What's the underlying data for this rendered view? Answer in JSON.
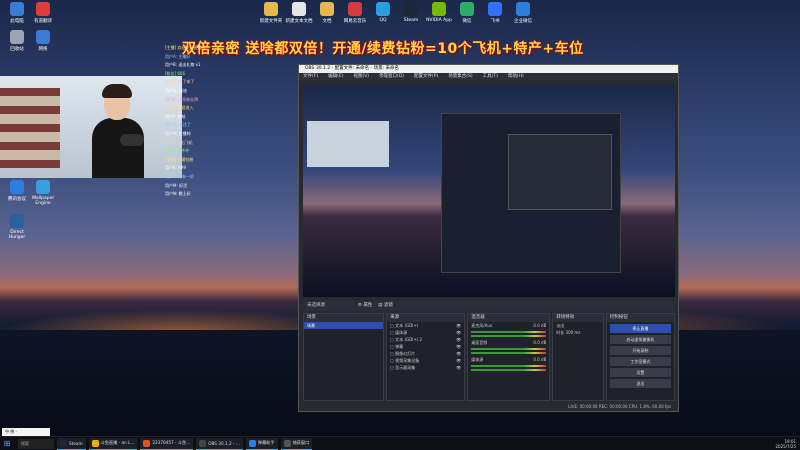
{
  "desktop": {
    "banner": "双倍亲密 送啥都双倍！开通/续费钻粉=10个飞机+特产+车位",
    "icons_left": [
      {
        "label": "此电脑",
        "color": "#3a7bd5"
      },
      {
        "label": "有道翻译",
        "color": "#e23b3b"
      },
      {
        "label": "回收站",
        "color": "#9aa6b2"
      },
      {
        "label": "网络",
        "color": "#3a7bd5"
      },
      {
        "label": "腾讯会议",
        "color": "#2a7fe0"
      },
      {
        "label": "Wallpaper Engine",
        "color": "#3a9fe0"
      },
      {
        "label": "Direct Hunger",
        "color": "#2a5fa0"
      }
    ],
    "icons_top": [
      {
        "label": "新建文件夹",
        "color": "#e6b84a"
      },
      {
        "label": "新建文本文档",
        "color": "#e6e6e6"
      },
      {
        "label": "文档",
        "color": "#e6b84a"
      },
      {
        "label": "网易云音乐",
        "color": "#d83b3b"
      },
      {
        "label": "QQ",
        "color": "#2a9fe0"
      },
      {
        "label": "Steam",
        "color": "#1b2838"
      },
      {
        "label": "NVIDIA App",
        "color": "#76b900"
      },
      {
        "label": "微信",
        "color": "#2aae67"
      },
      {
        "label": "飞书",
        "color": "#3370ff"
      },
      {
        "label": "企业微信",
        "color": "#2a7fe0"
      }
    ]
  },
  "chat": {
    "lines": [
      "[主播] 欢迎来到直播间",
      "用户A: 主播好",
      "用户B: 送出礼物 x1",
      "[粉丝] 666",
      "用户C: 来了来了",
      "用户D: 加油",
      "用户E: 点亮粉丝牌",
      "[系统] 欢迎进入",
      "用户F: 哈哈",
      "用户G: 关注了",
      "用户H: 主播帅",
      "用户I: 送出飞机",
      "用户J: 冲冲冲",
      "[系统] 开通钻粉",
      "用户K: 999",
      "用户L: 再来一把",
      "用户M: 好活",
      "用户N: 晚上好"
    ]
  },
  "obs": {
    "title": "OBS 30.1.2 - 配置文件: 未命名 - 场景: 未命名",
    "menu": [
      "文件(F)",
      "编辑(E)",
      "视图(V)",
      "停靠窗口(D)",
      "配置文件(P)",
      "场景集合(S)",
      "工具(T)",
      "帮助(H)"
    ],
    "source_bar": [
      "未选择源",
      "属性",
      "滤镜"
    ],
    "panels": {
      "scenes": {
        "title": "场景",
        "items": [
          "场景"
        ]
      },
      "sources": {
        "title": "来源",
        "items": [
          "文本 (GDI+)",
          "媒体源",
          "文本 (GDI+) 2",
          "弹幕",
          "图像幻灯片",
          "视频采集设备",
          "显示器采集"
        ]
      },
      "mixer": {
        "title": "混音器",
        "channels": [
          {
            "name": "麦克风/Aux",
            "db": "0.0 dB"
          },
          {
            "name": "桌面音频",
            "db": "0.0 dB"
          },
          {
            "name": "媒体源",
            "db": "0.0 dB"
          }
        ]
      },
      "transitions": {
        "title": "转场特效",
        "type": "淡出",
        "duration_label": "时长",
        "duration": "300 ms"
      },
      "controls": {
        "title": "控制按钮",
        "buttons": [
          "停止直播",
          "启动虚拟摄像机",
          "开始录制",
          "工作室模式",
          "设置",
          "退出"
        ]
      }
    },
    "status": "LIVE: 00:00:00   REC: 00:00:00   CPU: 1.8%, 60.00 fps"
  },
  "taskbar": {
    "search": "搜索",
    "items": [
      {
        "label": "Steam",
        "color": "#1b2838"
      },
      {
        "label": "斗鱼直播 - an L...",
        "color": "#f2a900"
      },
      {
        "label": "22370457 - 斗鱼...",
        "color": "#e0502a"
      },
      {
        "label": "OBS 30.1.2 - ...",
        "color": "#444"
      },
      {
        "label": "弹幕助手",
        "color": "#2a7fe0"
      },
      {
        "label": "捕获窗口",
        "color": "#555"
      }
    ],
    "time": "19:01",
    "date": "2025/7/25"
  },
  "ime": "中 拼 ·"
}
